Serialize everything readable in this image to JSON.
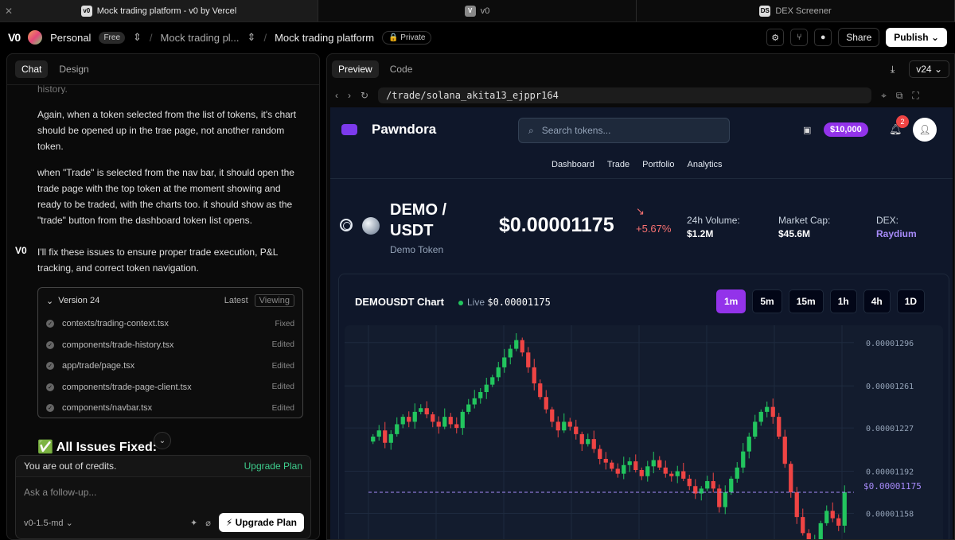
{
  "browser": {
    "tabs": [
      {
        "title": "Mock trading platform - v0 by Vercel",
        "favicon": "v0"
      },
      {
        "title": "v0",
        "favicon": "V"
      },
      {
        "title": "DEX Screener",
        "favicon": "DS"
      }
    ]
  },
  "header": {
    "logo": "V0",
    "workspace": "Personal",
    "plan": "Free",
    "crumb1": "Mock trading pl...",
    "project": "Mock trading platform",
    "visibility": "Private",
    "share": "Share",
    "publish": "Publish"
  },
  "chat": {
    "tabs": [
      "Chat",
      "Design"
    ],
    "faded": "history.",
    "msg1": "Again, when a token selected from the list of tokens, it's chart should be opened up in the trae page, not another random token.",
    "msg2": "when \"Trade\" is selected from the nav bar, it should open the trade page with the top token at the moment showing and ready to be traded, with the charts too. it should show as the \"trade\" button from the dashboard token list opens.",
    "reply": "I'll fix these issues to ensure proper trade execution, P&L tracking, and correct token navigation.",
    "version": {
      "label": "Version 24",
      "latest": "Latest",
      "viewing": "Viewing",
      "files": [
        {
          "path": "contexts/trading-context.tsx",
          "status": "Fixed"
        },
        {
          "path": "components/trade-history.tsx",
          "status": "Edited"
        },
        {
          "path": "app/trade/page.tsx",
          "status": "Edited"
        },
        {
          "path": "components/trade-page-client.tsx",
          "status": "Edited"
        },
        {
          "path": "components/navbar.tsx",
          "status": "Edited"
        }
      ]
    },
    "all_fixed": "✅ All Issues Fixed:",
    "credits": "You are out of credits.",
    "upgrade_link": "Upgrade Plan",
    "placeholder": "Ask a follow-up...",
    "model": "v0-1.5-md",
    "upgrade_button": "Upgrade Plan"
  },
  "preview": {
    "tabs": [
      "Preview",
      "Code"
    ],
    "version": "v24",
    "url": "/trade/solana_akita13_ejppr164",
    "app": {
      "brand": "Pawndora",
      "search_placeholder": "Search tokens...",
      "balance": "$10,000",
      "notifications": "2",
      "nav": [
        "Dashboard",
        "Trade",
        "Portfolio",
        "Analytics"
      ],
      "pair": "DEMO / USDT",
      "token_name": "Demo Token",
      "price": "$0.00001175",
      "change": "+5.67%",
      "stats": [
        {
          "label": "24h Volume:",
          "value": "$1.2M"
        },
        {
          "label": "Market Cap:",
          "value": "$45.6M"
        },
        {
          "label": "DEX:",
          "value": "Raydium"
        }
      ],
      "chart_title": "DEMOUSDT Chart",
      "live_label": "Live",
      "live_price": "$0.00001175",
      "timeframes": [
        "1m",
        "5m",
        "15m",
        "1h",
        "4h",
        "1D"
      ],
      "active_timeframe": "1m"
    }
  },
  "chart_data": {
    "type": "candlestick",
    "y_ticks": [
      "0.00001296",
      "0.00001261",
      "0.00001227",
      "0.00001192",
      "0.00001158"
    ],
    "current_price_label": "$0.00001175",
    "current_price": 1.175e-05,
    "ylim": [
      1.13e-05,
      1.31e-05
    ],
    "colors": {
      "up": "#22c55e",
      "down": "#ef4444",
      "price_line": "#a78bfa"
    },
    "close": [
      1.22e-05,
      1.225e-05,
      1.215e-05,
      1.222e-05,
      1.23e-05,
      1.236e-05,
      1.232e-05,
      1.24e-05,
      1.243e-05,
      1.238e-05,
      1.232e-05,
      1.228e-05,
      1.236e-05,
      1.23e-05,
      1.227e-05,
      1.24e-05,
      1.246e-05,
      1.251e-05,
      1.256e-05,
      1.262e-05,
      1.268e-05,
      1.276e-05,
      1.284e-05,
      1.291e-05,
      1.298e-05,
      1.288e-05,
      1.276e-05,
      1.263e-05,
      1.252e-05,
      1.242e-05,
      1.232e-05,
      1.225e-05,
      1.232e-05,
      1.228e-05,
      1.222e-05,
      1.214e-05,
      1.218e-05,
      1.21e-05,
      1.202e-05,
      1.199e-05,
      1.194e-05,
      1.19e-05,
      1.197e-05,
      1.2e-05,
      1.193e-05,
      1.188e-05,
      1.196e-05,
      1.201e-05,
      1.195e-05,
      1.19e-05,
      1.188e-05,
      1.192e-05,
      1.186e-05,
      1.18e-05,
      1.174e-05,
      1.178e-05,
      1.184e-05,
      1.178e-05,
      1.163e-05,
      1.175e-05,
      1.186e-05,
      1.195e-05,
      1.208e-05,
      1.22e-05,
      1.232e-05,
      1.24e-05,
      1.244e-05,
      1.236e-05,
      1.22e-05,
      1.198e-05,
      1.175e-05,
      1.155e-05,
      1.142e-05,
      1.13e-05,
      1.135e-05,
      1.15e-05,
      1.16e-05,
      1.154e-05,
      1.148e-05,
      1.175e-05
    ]
  }
}
